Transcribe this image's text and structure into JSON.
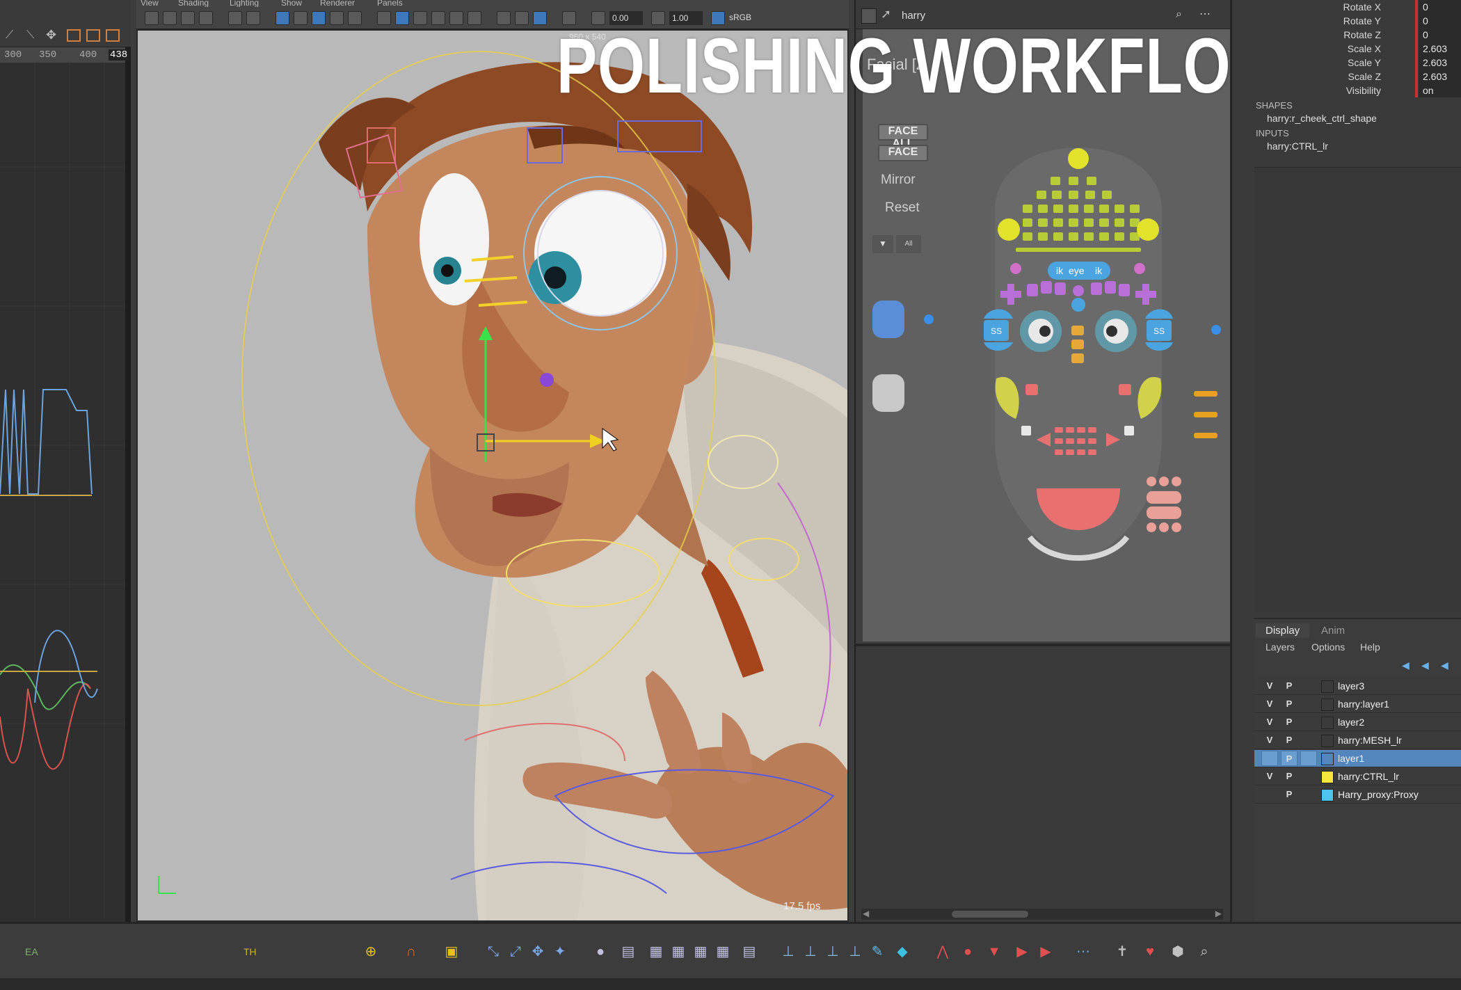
{
  "viewport": {
    "menu": [
      "View",
      "Shading",
      "Lighting",
      "Show",
      "Renderer",
      "Panels"
    ],
    "field1": "0.00",
    "field2": "1.00",
    "color_space": "sRGB",
    "resolution": "960 x 540",
    "fps": "17.5 fps",
    "title_overlay": "POLISHING WORKFLOW"
  },
  "graph_editor": {
    "ruler": [
      "300",
      "350",
      "400",
      "438"
    ]
  },
  "picker": {
    "character": "harry",
    "tab": "Facial [Z",
    "buttons": [
      "FACE ALL",
      "FACE",
      "Mirror",
      "Reset"
    ],
    "dropdown_value": "All",
    "eye_labels": [
      "ik",
      "eye",
      "ik"
    ],
    "side_labels": [
      "SS",
      "SS"
    ]
  },
  "attributes": [
    {
      "label": "Rotate X",
      "value": "0"
    },
    {
      "label": "Rotate Y",
      "value": "0"
    },
    {
      "label": "Rotate Z",
      "value": "0"
    },
    {
      "label": "Scale X",
      "value": "2.603"
    },
    {
      "label": "Scale Y",
      "value": "2.603"
    },
    {
      "label": "Scale Z",
      "value": "2.603"
    },
    {
      "label": "Visibility",
      "value": "on"
    }
  ],
  "sections": {
    "shapes_label": "SHAPES",
    "shapes_item": "harry:r_cheek_ctrl_shape",
    "inputs_label": "INPUTS",
    "inputs_item": "harry:CTRL_lr"
  },
  "layer_editor": {
    "tabs": [
      "Display",
      "Anim"
    ],
    "menus": [
      "Layers",
      "Options",
      "Help"
    ],
    "layers": [
      {
        "v": "V",
        "p": "P",
        "name": "layer3"
      },
      {
        "v": "V",
        "p": "P",
        "name": "harry:layer1"
      },
      {
        "v": "V",
        "p": "P",
        "name": "layer2"
      },
      {
        "v": "V",
        "p": "P",
        "name": "harry:MESH_lr"
      },
      {
        "v": "",
        "p": "P",
        "name": "layer1"
      },
      {
        "v": "V",
        "p": "P",
        "name": "harry:CTRL_lr"
      },
      {
        "v": "",
        "p": "P",
        "name": "Harry_proxy:Proxy"
      }
    ],
    "layer_colors": [
      "",
      "",
      "",
      "",
      "",
      "#f5e63c",
      "#4fc3f0"
    ]
  },
  "timeline": {
    "left_labels": [
      "EA",
      "TH"
    ]
  }
}
